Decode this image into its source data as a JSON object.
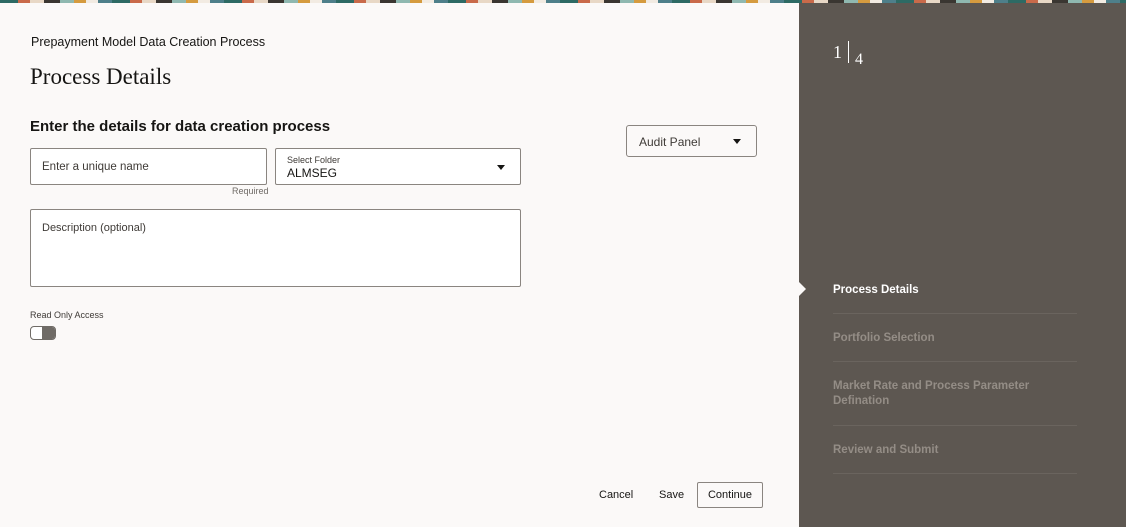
{
  "header": {
    "subtitle": "Prepayment Model Data Creation Process",
    "title": "Process Details"
  },
  "form": {
    "section_title": "Enter the details for data creation process",
    "name_placeholder": "Enter a unique name",
    "name_helper": "Required",
    "folder_label": "Select Folder",
    "folder_value": "ALMSEG",
    "description_placeholder": "Description (optional)",
    "read_only_label": "Read Only Access"
  },
  "audit_panel": {
    "label": "Audit Panel"
  },
  "footer": {
    "cancel_label": "Cancel",
    "save_label": "Save",
    "continue_label": "Continue"
  },
  "train": {
    "current_step": "1",
    "total_steps": "4",
    "steps": [
      {
        "label": "Process Details",
        "state": "active"
      },
      {
        "label": "Portfolio Selection",
        "state": "inactive"
      },
      {
        "label": "Market Rate and Process Parameter Defination",
        "state": "inactive"
      },
      {
        "label": "Review and Submit",
        "state": "inactive"
      }
    ]
  },
  "colors": {
    "sidebar_bg": "#5d5751",
    "page_bg": "#fbf9f8"
  }
}
